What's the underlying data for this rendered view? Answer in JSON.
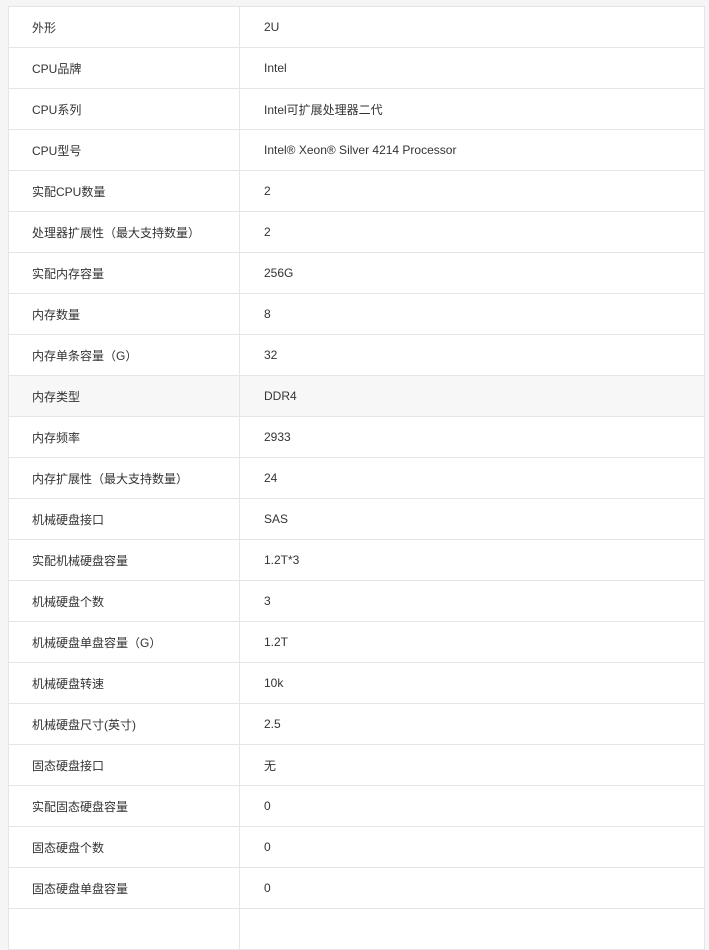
{
  "spec_table": {
    "rows": [
      {
        "label": "外形",
        "value": "2U"
      },
      {
        "label": "CPU品牌",
        "value": "Intel"
      },
      {
        "label": "CPU系列",
        "value": "Intel可扩展处理器二代"
      },
      {
        "label": "CPU型号",
        "value": "Intel® Xeon® Silver 4214 Processor"
      },
      {
        "label": "实配CPU数量",
        "value": "2"
      },
      {
        "label": "处理器扩展性（最大支持数量）",
        "value": "2"
      },
      {
        "label": "实配内存容量",
        "value": "256G"
      },
      {
        "label": "内存数量",
        "value": "8"
      },
      {
        "label": "内存单条容量（G）",
        "value": "32"
      },
      {
        "label": "内存类型",
        "value": "DDR4"
      },
      {
        "label": "内存频率",
        "value": "2933"
      },
      {
        "label": "内存扩展性（最大支持数量）",
        "value": "24"
      },
      {
        "label": "机械硬盘接口",
        "value": "SAS"
      },
      {
        "label": "实配机械硬盘容量",
        "value": "1.2T*3"
      },
      {
        "label": "机械硬盘个数",
        "value": "3"
      },
      {
        "label": "机械硬盘单盘容量（G）",
        "value": "1.2T"
      },
      {
        "label": "机械硬盘转速",
        "value": "10k"
      },
      {
        "label": "机械硬盘尺寸(英寸)",
        "value": "2.5"
      },
      {
        "label": "固态硬盘接口",
        "value": "无"
      },
      {
        "label": "实配固态硬盘容量",
        "value": "0"
      },
      {
        "label": "固态硬盘个数",
        "value": "0"
      },
      {
        "label": "固态硬盘单盘容量",
        "value": "0"
      },
      {
        "label": "",
        "value": ""
      }
    ]
  }
}
